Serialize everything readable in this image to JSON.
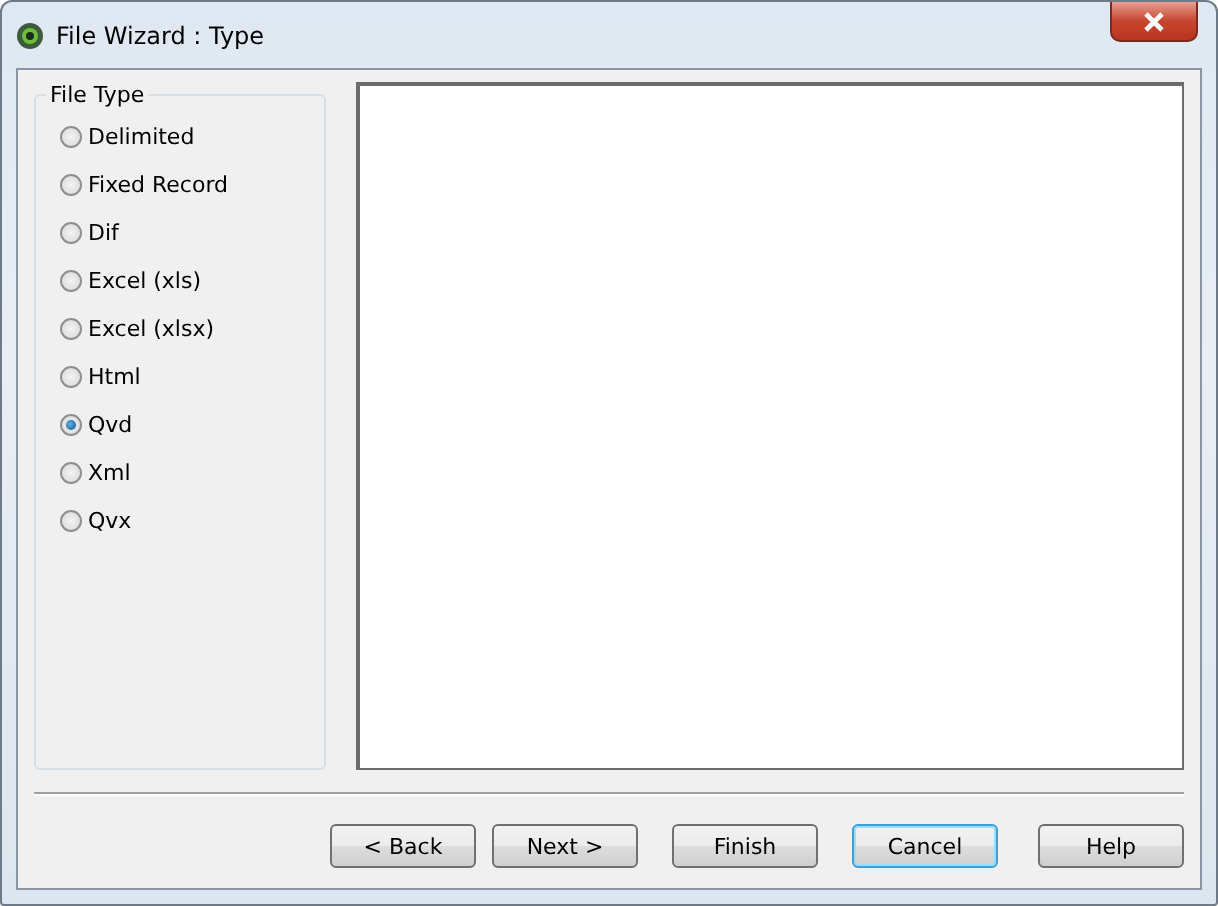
{
  "window": {
    "title": "File Wizard : Type"
  },
  "file_type": {
    "legend": "File Type",
    "options": [
      {
        "label": "Delimited",
        "selected": false
      },
      {
        "label": "Fixed Record",
        "selected": false
      },
      {
        "label": "Dif",
        "selected": false
      },
      {
        "label": "Excel (xls)",
        "selected": false
      },
      {
        "label": "Excel (xlsx)",
        "selected": false
      },
      {
        "label": "Html",
        "selected": false
      },
      {
        "label": "Qvd",
        "selected": true
      },
      {
        "label": "Xml",
        "selected": false
      },
      {
        "label": "Qvx",
        "selected": false
      }
    ]
  },
  "buttons": [
    {
      "label": "< Back",
      "focused": false
    },
    {
      "label": "Next >",
      "focused": false
    },
    {
      "label": "Finish",
      "focused": false
    },
    {
      "label": "Cancel",
      "focused": true
    },
    {
      "label": "Help",
      "focused": false
    }
  ]
}
